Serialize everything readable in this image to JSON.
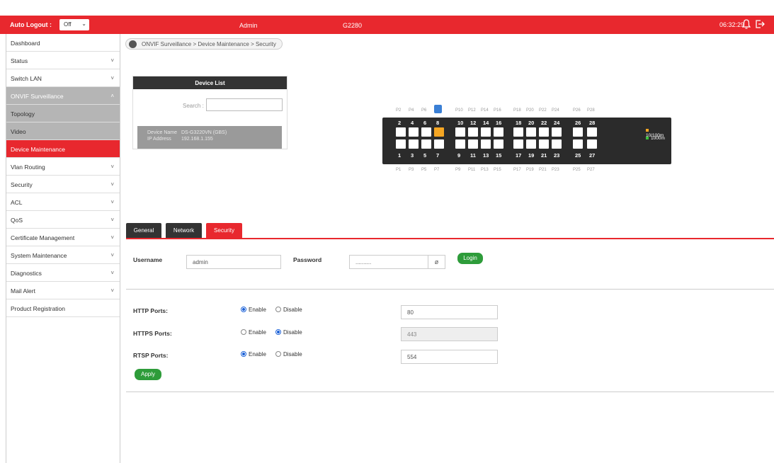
{
  "header": {
    "auto_logout_label": "Auto Logout :",
    "auto_logout_value": "Off",
    "user": "Admin",
    "model": "G2280",
    "time": "06:32:29"
  },
  "sidebar": {
    "items": [
      {
        "label": "Dashboard",
        "chev": ""
      },
      {
        "label": "Status",
        "chev": "˅"
      },
      {
        "label": "Switch LAN",
        "chev": "˅"
      },
      {
        "label": "ONVIF Surveillance",
        "chev": "˄"
      },
      {
        "label": "Topology",
        "chev": ""
      },
      {
        "label": "Video",
        "chev": ""
      },
      {
        "label": "Device Maintenance",
        "chev": ""
      },
      {
        "label": "Vlan Routing",
        "chev": "˅"
      },
      {
        "label": "Security",
        "chev": "˅"
      },
      {
        "label": "ACL",
        "chev": "˅"
      },
      {
        "label": "QoS",
        "chev": "˅"
      },
      {
        "label": "Certificate Management",
        "chev": "˅"
      },
      {
        "label": "System Maintenance",
        "chev": "˅"
      },
      {
        "label": "Diagnostics",
        "chev": "˅"
      },
      {
        "label": "Mail Alert",
        "chev": "˅"
      },
      {
        "label": "Product Registration",
        "chev": ""
      }
    ]
  },
  "breadcrumb": "ONVIF Surveillance > Device Maintenance > Security",
  "device_list": {
    "title": "Device List",
    "search_label": "Search :",
    "device_name_label": "Device Name",
    "device_name": "DS-G3220VN (GBS)",
    "ip_label": "IP Address",
    "ip": "192.168.1.155"
  },
  "switch": {
    "top_labels": [
      "P2",
      "P4",
      "P6",
      "",
      "P10",
      "P12",
      "P14",
      "P16",
      "P18",
      "P20",
      "P22",
      "P24",
      "P26",
      "P28"
    ],
    "top_numbers": [
      "2",
      "4",
      "6",
      "8",
      "10",
      "12",
      "14",
      "16",
      "18",
      "20",
      "22",
      "24",
      "26",
      "28"
    ],
    "bottom_numbers": [
      "1",
      "3",
      "5",
      "7",
      "9",
      "11",
      "13",
      "15",
      "17",
      "19",
      "21",
      "23",
      "25",
      "27"
    ],
    "bottom_labels": [
      "P1",
      "P3",
      "P5",
      "P7",
      "P9",
      "P11",
      "P13",
      "P15",
      "P17",
      "P19",
      "P21",
      "P23",
      "P25",
      "P27"
    ],
    "legend_10_100": "10/100m",
    "legend_1000": "1000m",
    "color_10_100": "#f5a623",
    "color_1000": "#3ec13e"
  },
  "tabs": [
    "General",
    "Network",
    "Security"
  ],
  "login": {
    "username_label": "Username",
    "username_value": "admin",
    "password_label": "Password",
    "password_value": "..........",
    "login_button": "Login"
  },
  "ports": {
    "http_label": "HTTP Ports:",
    "https_label": "HTTPS Ports:",
    "rtsp_label": "RTSP Ports:",
    "enable_label": "Enable",
    "disable_label": "Disable",
    "http_value": "80",
    "https_value": "443",
    "rtsp_value": "554",
    "apply_button": "Apply"
  },
  "colors": {
    "brand": "#e8282e",
    "button": "#2e9c3a",
    "radio": "#1e63d8"
  }
}
